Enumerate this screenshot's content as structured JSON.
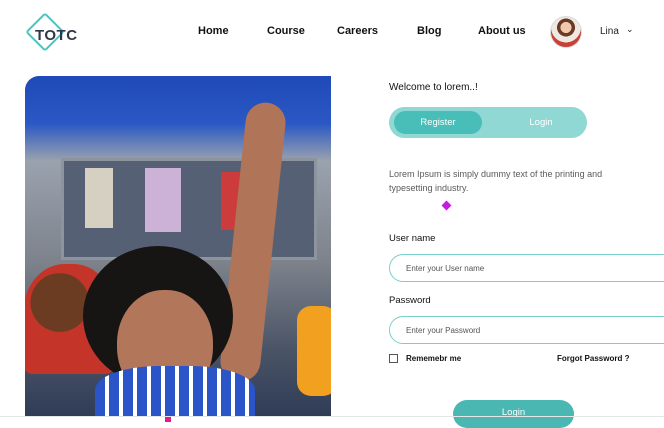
{
  "brand": {
    "logo_text": "TOTC",
    "accent": "#49c5c0"
  },
  "nav": {
    "items": [
      {
        "label": "Home"
      },
      {
        "label": "Course"
      },
      {
        "label": "Careers"
      },
      {
        "label": "Blog"
      },
      {
        "label": "About us"
      }
    ]
  },
  "user": {
    "name": "Lina",
    "menu_icon": "chevron-down-icon"
  },
  "form": {
    "welcome": "Welcome to lorem..!",
    "tabs": {
      "register": "Register",
      "login": "Login",
      "active": "Register"
    },
    "description": "Lorem Ipsum is simply dummy text of the printing and typesetting industry.",
    "username_label": "User name",
    "username_placeholder": "Enter your User name",
    "password_label": "Password",
    "password_placeholder": "Enter your Password",
    "remember_label": "Rememebr me",
    "forgot_label": "Forgot Password ?",
    "submit_label": "Login"
  },
  "colors": {
    "toggle_bg": "#8fd8d4",
    "toggle_active": "#49bdb7",
    "button": "#4ab7b3"
  }
}
